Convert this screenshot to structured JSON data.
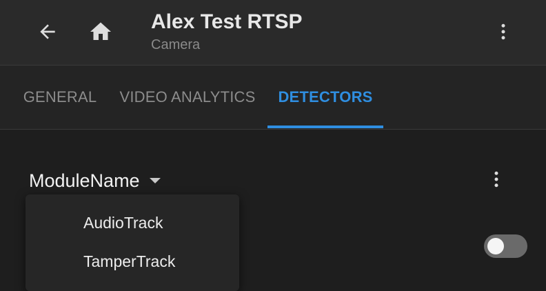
{
  "header": {
    "title": "Alex Test RTSP",
    "subtitle": "Camera",
    "back_icon": "arrow-left-icon",
    "home_icon": "home-icon",
    "more_icon": "more-vertical-icon"
  },
  "tabs": [
    {
      "label": "GENERAL",
      "active": false
    },
    {
      "label": "VIDEO ANALYTICS",
      "active": false
    },
    {
      "label": "DETECTORS",
      "active": true
    }
  ],
  "module_selector": {
    "label": "ModuleName",
    "caret_icon": "caret-down-icon",
    "more_icon": "more-vertical-icon"
  },
  "dropdown": {
    "options": [
      "AudioTrack",
      "TamperTrack"
    ]
  },
  "toggle": {
    "state": "off"
  },
  "colors": {
    "accent": "#2f8ee0",
    "icon": "#dddddd",
    "toggle_track_off": "#6a6a6a",
    "toggle_knob_off": "#f5f5f5"
  }
}
